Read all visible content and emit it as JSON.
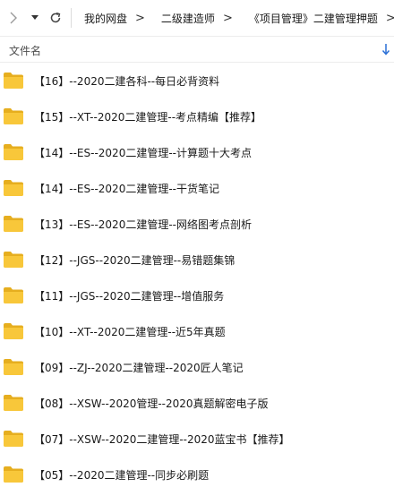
{
  "toolbar": {
    "icons": {
      "back": "chevron-right-icon",
      "dropdown": "chevron-down-icon",
      "refresh": "refresh-icon"
    },
    "breadcrumbs": [
      "我的网盘",
      "二级建造师",
      "《项目管理》二建管理押题"
    ],
    "separator": ">"
  },
  "header": {
    "name_label": "文件名",
    "sort_icon": "sort-arrow-down-icon"
  },
  "files": [
    "【16】--2020二建各科--每日必背资料",
    "【15】--XT--2020二建管理--考点精编【推荐】",
    "【14】--ES--2020二建管理--计算题十大考点",
    "【14】--ES--2020二建管理--干货笔记",
    "【13】--ES--2020二建管理--网络图考点剖析",
    "【12】--JGS--2020二建管理--易错题集锦",
    "【11】--JGS--2020二建管理--增值服务",
    "【10】--XT--2020二建管理--近5年真题",
    "【09】--ZJ--2020二建管理--2020匠人笔记",
    "【08】--XSW--2020管理--2020真题解密电子版",
    "【07】--XSW--2020二建管理--2020蓝宝书【推荐】",
    "【05】--2020二建管理--同步必刷题"
  ],
  "colors": {
    "folder": "#f8c73a",
    "folder_dark": "#e6ae1f",
    "accent": "#2a6fd6"
  }
}
